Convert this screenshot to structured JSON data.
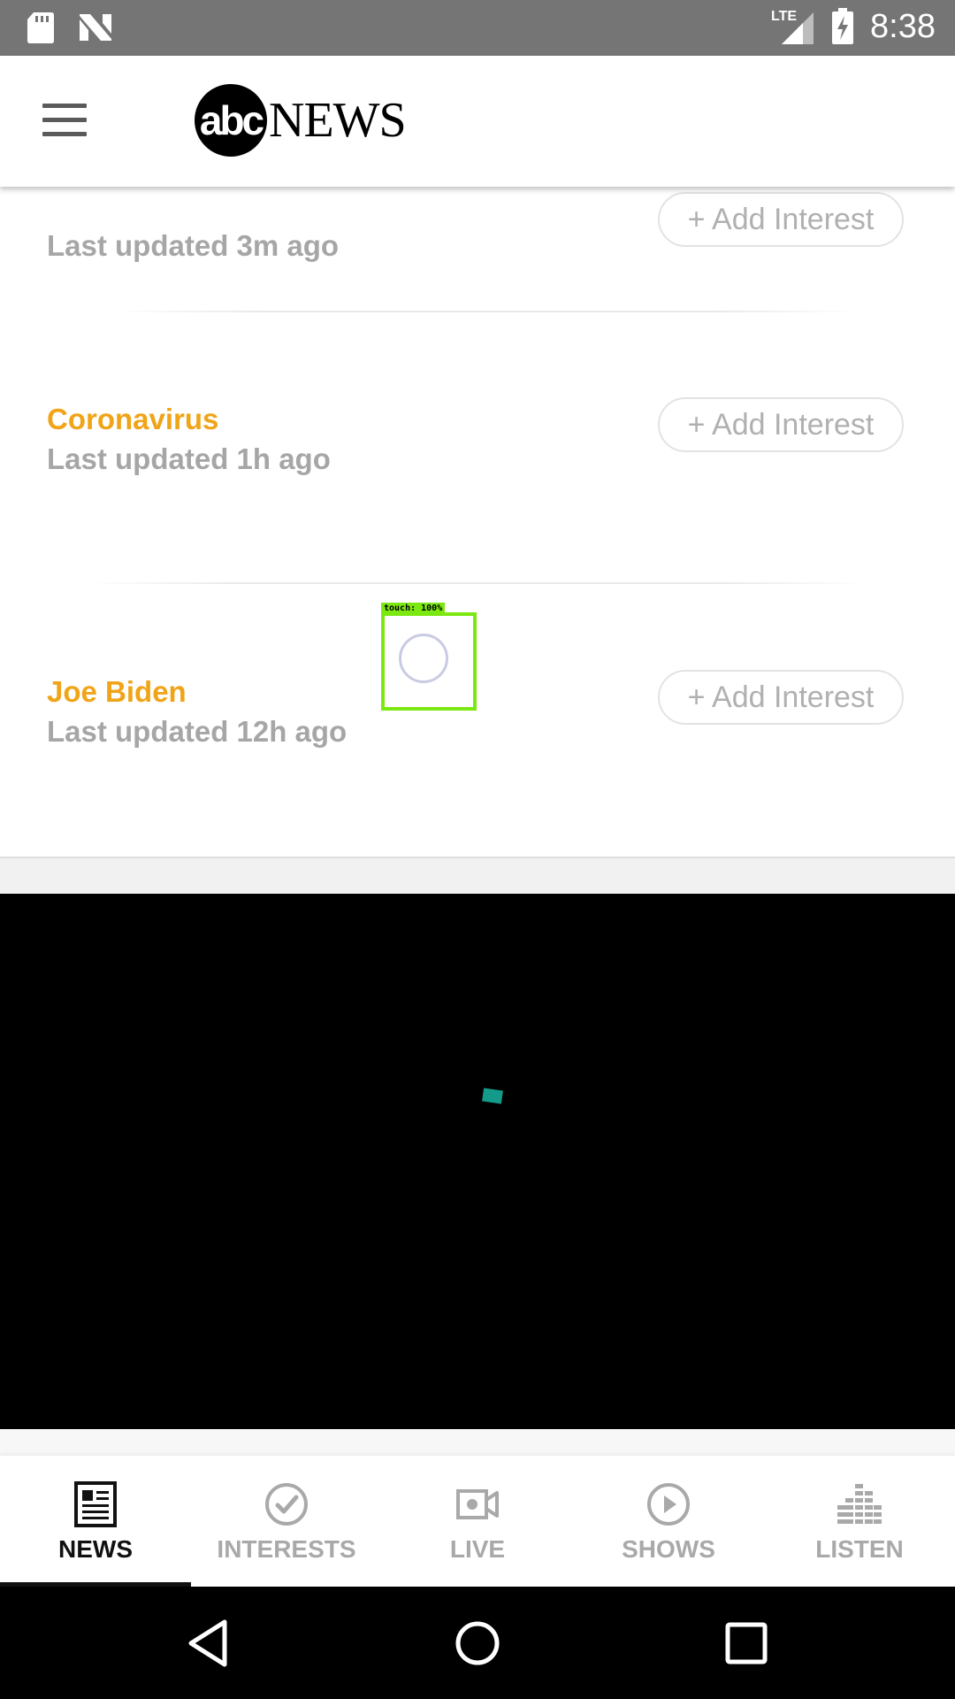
{
  "status_bar": {
    "network": "LTE",
    "time": "8:38"
  },
  "header": {
    "logo_abc": "abc",
    "logo_news": "NEWS"
  },
  "topics": [
    {
      "title": "",
      "updated": "Last updated 3m ago",
      "button": "+ Add Interest"
    },
    {
      "title": "Coronavirus",
      "updated": "Last updated 1h ago",
      "button": "+ Add Interest"
    },
    {
      "title": "Joe Biden",
      "updated": "Last updated 12h ago",
      "button": "+ Add Interest"
    }
  ],
  "touch_overlay": {
    "label": "touch: 100%"
  },
  "bottom_nav": {
    "items": [
      {
        "label": "NEWS",
        "icon": "newspaper-icon",
        "active": true
      },
      {
        "label": "INTERESTS",
        "icon": "checkmark-circle-icon",
        "active": false
      },
      {
        "label": "LIVE",
        "icon": "video-camera-icon",
        "active": false
      },
      {
        "label": "SHOWS",
        "icon": "play-circle-icon",
        "active": false
      },
      {
        "label": "LISTEN",
        "icon": "equalizer-icon",
        "active": false
      }
    ]
  },
  "colors": {
    "accent": "#f0a418",
    "muted_text": "#a6a6a6",
    "status_bar": "#757575",
    "touch_highlight": "#7ce812"
  }
}
